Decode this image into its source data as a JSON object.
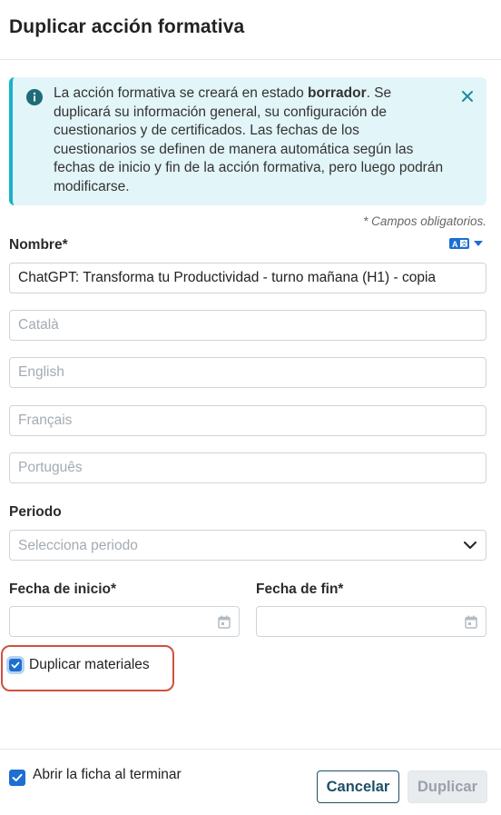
{
  "modal": {
    "title": "Duplicar acción formativa"
  },
  "alert": {
    "text_before": "La acción formativa se creará en estado ",
    "text_bold": "borrador",
    "text_after": ". Se duplicará su información general, su configuración de cuestionarios y de certificados. Las fechas de los cuestionarios se definen de manera automática según las fechas de inicio y fin de la acción formativa, pero luego podrán modificarse.",
    "icon": "info-icon",
    "close_icon": "close-icon"
  },
  "form": {
    "required_note": "* Campos obligatorios.",
    "name_label": "Nombre*",
    "name_value": "ChatGPT: Transforma tu Productividad - turno mañana (H1) - copia",
    "translations": [
      {
        "placeholder": "Català"
      },
      {
        "placeholder": "English"
      },
      {
        "placeholder": "Français"
      },
      {
        "placeholder": "Português"
      }
    ],
    "period_label": "Periodo",
    "period_placeholder": "Selecciona periodo",
    "start_label": "Fecha de inicio*",
    "end_label": "Fecha de fin*",
    "duplicate_materials_label": "Duplicar materiales",
    "duplicate_materials_checked": true
  },
  "footer": {
    "open_after_label": "Abrir la ficha al terminar",
    "open_after_checked": true,
    "cancel_label": "Cancelar",
    "duplicate_label": "Duplicar"
  },
  "colors": {
    "accent": "#1d6fd1",
    "alert_bg": "#e2f5f8",
    "alert_border": "#18b2c9",
    "highlight": "#d0503f",
    "cancel_border": "#1d4f68"
  }
}
